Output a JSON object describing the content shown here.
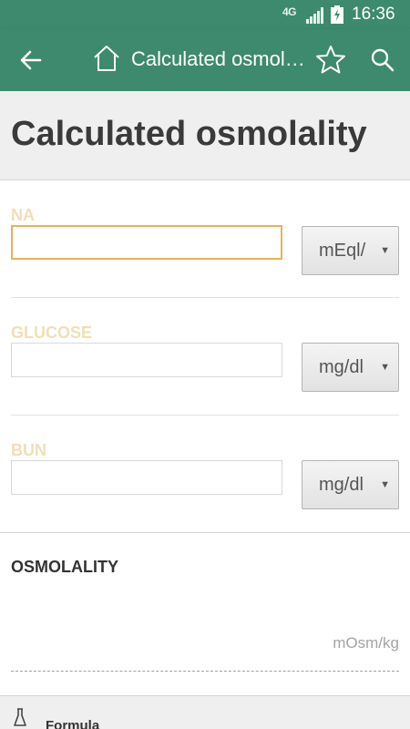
{
  "status_bar": {
    "network": "4G",
    "time": "16:36"
  },
  "app_bar": {
    "title": "Calculated osmola…"
  },
  "page": {
    "title": "Calculated osmolality"
  },
  "fields": [
    {
      "label": "NA",
      "value": "",
      "unit": "mEql/"
    },
    {
      "label": "GLUCOSE",
      "value": "",
      "unit": "mg/dl"
    },
    {
      "label": "BUN",
      "value": "",
      "unit": "mg/dl"
    }
  ],
  "result": {
    "label": "OSMOLALITY",
    "unit": "mOsm/kg"
  },
  "formula": {
    "label": "Formula"
  },
  "colors": {
    "primary": "#3d8a6e",
    "label_hint": "#f0dfb7",
    "focus": "#e6b35a"
  }
}
